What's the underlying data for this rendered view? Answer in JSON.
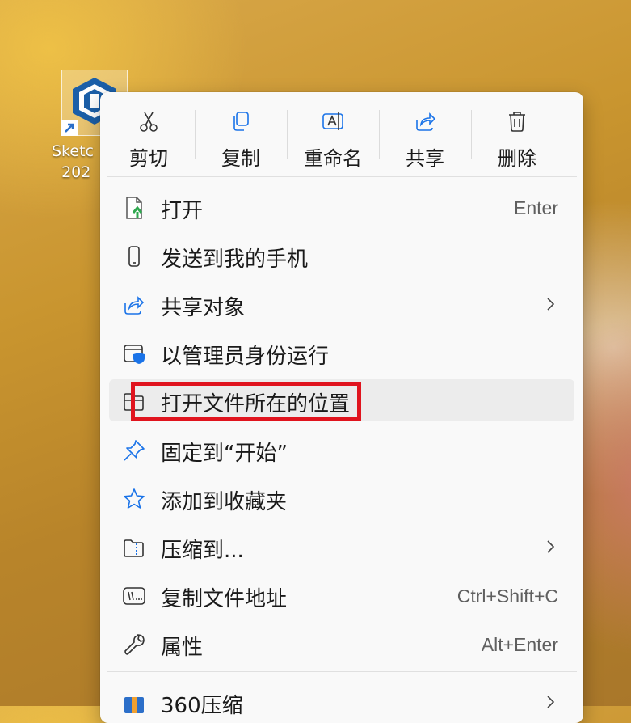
{
  "desktop": {
    "shortcut_label": "Sketc\n  202"
  },
  "toolbar": {
    "cut": "剪切",
    "copy": "复制",
    "rename": "重命名",
    "share": "共享",
    "delete": "删除"
  },
  "menu": {
    "items": [
      {
        "label": "打开",
        "shortcut": "Enter",
        "icon": "open-file-icon"
      },
      {
        "label": "发送到我的手机",
        "icon": "phone-icon"
      },
      {
        "label": "共享对象",
        "icon": "share-icon",
        "submenu": true
      },
      {
        "label": "以管理员身份运行",
        "icon": "shield-admin-icon"
      },
      {
        "label": "打开文件所在的位置",
        "icon": "folder-open-icon",
        "highlighted": true
      },
      {
        "label": "固定到“开始”",
        "icon": "pin-icon"
      },
      {
        "label": "添加到收藏夹",
        "icon": "star-icon"
      },
      {
        "label": "压缩到...",
        "icon": "zip-folder-icon",
        "submenu": true
      },
      {
        "label": "复制文件地址",
        "shortcut": "Ctrl+Shift+C",
        "icon": "copy-path-icon"
      },
      {
        "label": "属性",
        "shortcut": "Alt+Enter",
        "icon": "wrench-icon"
      },
      {
        "label": "360压缩",
        "icon": "archive-360-icon",
        "submenu": true
      }
    ]
  },
  "colors": {
    "accent": "#1a73e8",
    "highlight_box": "#e0141e",
    "menu_bg": "#f9f9f9"
  }
}
